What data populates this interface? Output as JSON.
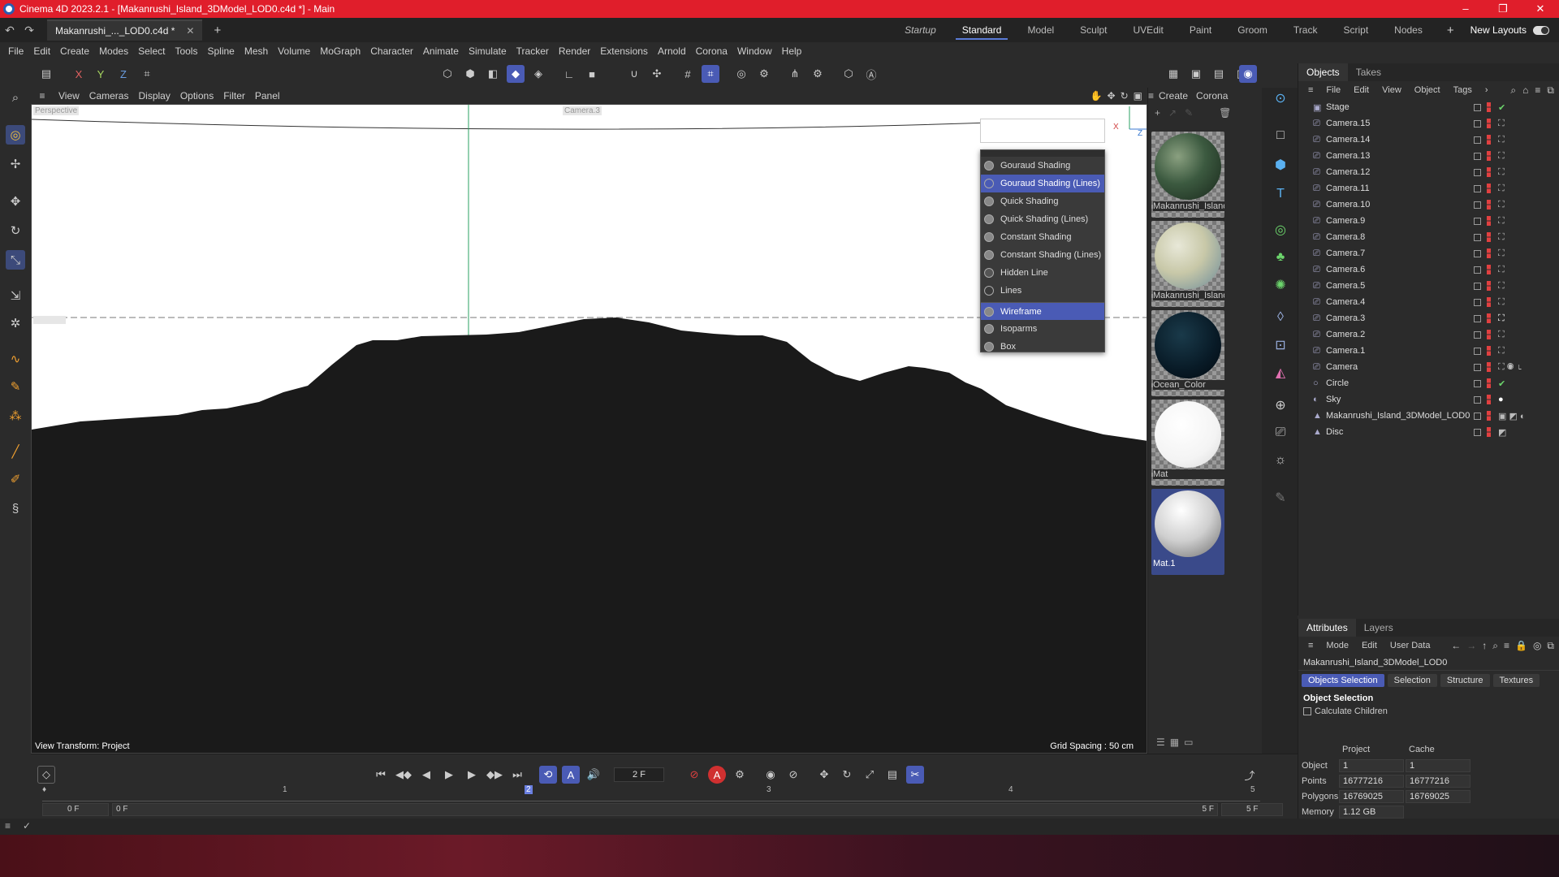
{
  "window": {
    "title": "Cinema 4D 2023.2.1 - [Makanrushi_Island_3DModel_LOD0.c4d *] - Main"
  },
  "doc_tab": {
    "label": "Makanrushi_..._LOD0.c4d *"
  },
  "layouts": [
    "Startup",
    "Standard",
    "Model",
    "Sculpt",
    "UVEdit",
    "Paint",
    "Groom",
    "Track",
    "Script",
    "Nodes"
  ],
  "active_layout": "Standard",
  "new_layouts_label": "New Layouts",
  "menu": [
    "File",
    "Edit",
    "Create",
    "Modes",
    "Select",
    "Tools",
    "Spline",
    "Mesh",
    "Volume",
    "MoGraph",
    "Character",
    "Animate",
    "Simulate",
    "Tracker",
    "Render",
    "Extensions",
    "Arnold",
    "Corona",
    "Window",
    "Help"
  ],
  "axis_labels": {
    "x": "X",
    "y": "Y",
    "z": "Z"
  },
  "viewport": {
    "menu": [
      "View",
      "Cameras",
      "Display",
      "Options",
      "Filter",
      "Panel"
    ],
    "label_perspective": "Perspective",
    "label_camera": "Camera.3",
    "status_left": "View Transform: Project",
    "status_right": "Grid Spacing : 50 cm",
    "axis_x": "X",
    "axis_z": "Z"
  },
  "shading_menu": {
    "items": [
      "Gouraud Shading",
      "Gouraud Shading (Lines)",
      "Quick Shading",
      "Quick Shading (Lines)",
      "Constant Shading",
      "Constant Shading (Lines)",
      "Hidden Line",
      "Lines",
      "Wireframe",
      "Isoparms",
      "Box"
    ],
    "highlighted": [
      "Gouraud Shading (Lines)",
      "Wireframe"
    ]
  },
  "materials": {
    "menu": [
      "Create",
      "Corona"
    ],
    "items": [
      {
        "name": "Makanrushi_Island"
      },
      {
        "name": "Makanrushi_Island"
      },
      {
        "name": "Ocean_Color"
      },
      {
        "name": "Mat"
      },
      {
        "name": "Mat.1"
      }
    ]
  },
  "objects_panel": {
    "tabs": [
      "Objects",
      "Takes"
    ],
    "menu": [
      "File",
      "Edit",
      "View",
      "Object",
      "Tags"
    ],
    "items": [
      "Stage",
      "Camera.15",
      "Camera.14",
      "Camera.13",
      "Camera.12",
      "Camera.11",
      "Camera.10",
      "Camera.9",
      "Camera.8",
      "Camera.7",
      "Camera.6",
      "Camera.5",
      "Camera.4",
      "Camera.3",
      "Camera.2",
      "Camera.1",
      "Camera",
      "Circle",
      "Sky",
      "Makanrushi_Island_3DModel_LOD0",
      "Disc"
    ]
  },
  "attributes_panel": {
    "tabs": [
      "Attributes",
      "Layers"
    ],
    "menu": [
      "Mode",
      "Edit",
      "User Data"
    ],
    "path": "Makanrushi_Island_3DModel_LOD0",
    "subtabs": [
      "Objects Selection",
      "Selection",
      "Structure",
      "Textures"
    ],
    "section": "Object Selection",
    "checkbox": "Calculate Children",
    "columns": [
      "Project",
      "Cache"
    ],
    "rows": [
      {
        "label": "Object",
        "project": "1",
        "cache": "1"
      },
      {
        "label": "Points",
        "project": "16777216",
        "cache": "16777216"
      },
      {
        "label": "Polygons",
        "project": "16769025",
        "cache": "16769025"
      },
      {
        "label": "Memory",
        "project": "1.12 GB",
        "cache": ""
      }
    ]
  },
  "timeline": {
    "current_frame": "2 F",
    "ruler_ticks": [
      "1",
      "2",
      "3",
      "4",
      "5"
    ],
    "start_field": "0 F",
    "range_start": "0 F",
    "range_end": "5 F",
    "end_field": "5 F",
    "record_label": "A"
  },
  "icons": {
    "colors": {
      "title_bar": "#e01e2b",
      "accent": "#4a5bb5",
      "timeline_playhead": "#6a7fe0"
    }
  }
}
